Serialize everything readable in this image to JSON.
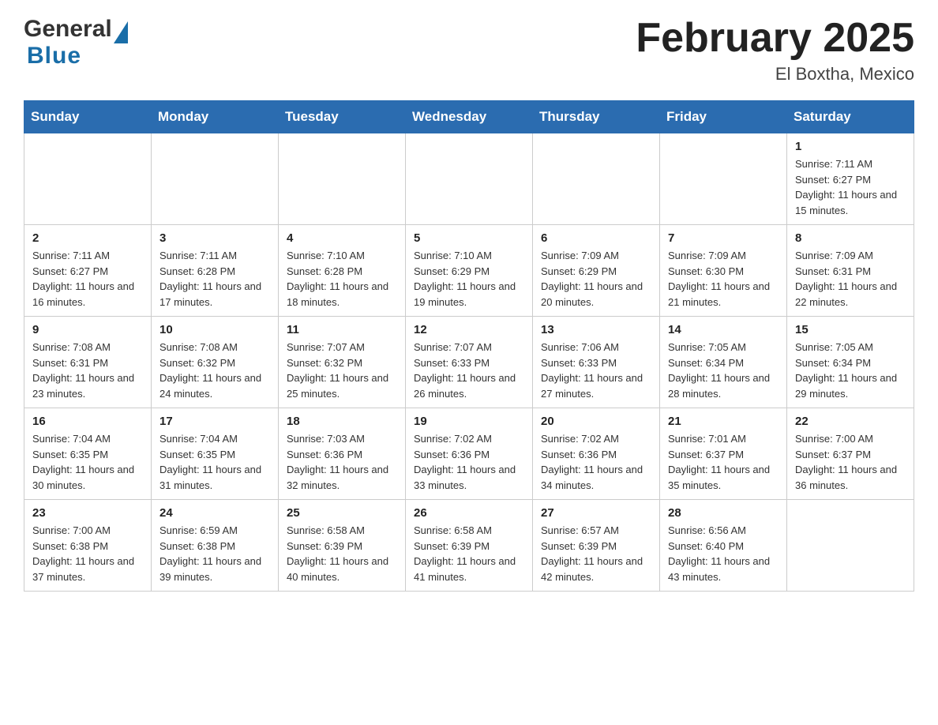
{
  "header": {
    "logo_general": "General",
    "logo_blue": "Blue",
    "month_title": "February 2025",
    "location": "El Boxtha, Mexico"
  },
  "weekdays": [
    "Sunday",
    "Monday",
    "Tuesday",
    "Wednesday",
    "Thursday",
    "Friday",
    "Saturday"
  ],
  "weeks": [
    {
      "days": [
        {
          "number": "",
          "info": ""
        },
        {
          "number": "",
          "info": ""
        },
        {
          "number": "",
          "info": ""
        },
        {
          "number": "",
          "info": ""
        },
        {
          "number": "",
          "info": ""
        },
        {
          "number": "",
          "info": ""
        },
        {
          "number": "1",
          "info": "Sunrise: 7:11 AM\nSunset: 6:27 PM\nDaylight: 11 hours and 15 minutes."
        }
      ]
    },
    {
      "days": [
        {
          "number": "2",
          "info": "Sunrise: 7:11 AM\nSunset: 6:27 PM\nDaylight: 11 hours and 16 minutes."
        },
        {
          "number": "3",
          "info": "Sunrise: 7:11 AM\nSunset: 6:28 PM\nDaylight: 11 hours and 17 minutes."
        },
        {
          "number": "4",
          "info": "Sunrise: 7:10 AM\nSunset: 6:28 PM\nDaylight: 11 hours and 18 minutes."
        },
        {
          "number": "5",
          "info": "Sunrise: 7:10 AM\nSunset: 6:29 PM\nDaylight: 11 hours and 19 minutes."
        },
        {
          "number": "6",
          "info": "Sunrise: 7:09 AM\nSunset: 6:29 PM\nDaylight: 11 hours and 20 minutes."
        },
        {
          "number": "7",
          "info": "Sunrise: 7:09 AM\nSunset: 6:30 PM\nDaylight: 11 hours and 21 minutes."
        },
        {
          "number": "8",
          "info": "Sunrise: 7:09 AM\nSunset: 6:31 PM\nDaylight: 11 hours and 22 minutes."
        }
      ]
    },
    {
      "days": [
        {
          "number": "9",
          "info": "Sunrise: 7:08 AM\nSunset: 6:31 PM\nDaylight: 11 hours and 23 minutes."
        },
        {
          "number": "10",
          "info": "Sunrise: 7:08 AM\nSunset: 6:32 PM\nDaylight: 11 hours and 24 minutes."
        },
        {
          "number": "11",
          "info": "Sunrise: 7:07 AM\nSunset: 6:32 PM\nDaylight: 11 hours and 25 minutes."
        },
        {
          "number": "12",
          "info": "Sunrise: 7:07 AM\nSunset: 6:33 PM\nDaylight: 11 hours and 26 minutes."
        },
        {
          "number": "13",
          "info": "Sunrise: 7:06 AM\nSunset: 6:33 PM\nDaylight: 11 hours and 27 minutes."
        },
        {
          "number": "14",
          "info": "Sunrise: 7:05 AM\nSunset: 6:34 PM\nDaylight: 11 hours and 28 minutes."
        },
        {
          "number": "15",
          "info": "Sunrise: 7:05 AM\nSunset: 6:34 PM\nDaylight: 11 hours and 29 minutes."
        }
      ]
    },
    {
      "days": [
        {
          "number": "16",
          "info": "Sunrise: 7:04 AM\nSunset: 6:35 PM\nDaylight: 11 hours and 30 minutes."
        },
        {
          "number": "17",
          "info": "Sunrise: 7:04 AM\nSunset: 6:35 PM\nDaylight: 11 hours and 31 minutes."
        },
        {
          "number": "18",
          "info": "Sunrise: 7:03 AM\nSunset: 6:36 PM\nDaylight: 11 hours and 32 minutes."
        },
        {
          "number": "19",
          "info": "Sunrise: 7:02 AM\nSunset: 6:36 PM\nDaylight: 11 hours and 33 minutes."
        },
        {
          "number": "20",
          "info": "Sunrise: 7:02 AM\nSunset: 6:36 PM\nDaylight: 11 hours and 34 minutes."
        },
        {
          "number": "21",
          "info": "Sunrise: 7:01 AM\nSunset: 6:37 PM\nDaylight: 11 hours and 35 minutes."
        },
        {
          "number": "22",
          "info": "Sunrise: 7:00 AM\nSunset: 6:37 PM\nDaylight: 11 hours and 36 minutes."
        }
      ]
    },
    {
      "days": [
        {
          "number": "23",
          "info": "Sunrise: 7:00 AM\nSunset: 6:38 PM\nDaylight: 11 hours and 37 minutes."
        },
        {
          "number": "24",
          "info": "Sunrise: 6:59 AM\nSunset: 6:38 PM\nDaylight: 11 hours and 39 minutes."
        },
        {
          "number": "25",
          "info": "Sunrise: 6:58 AM\nSunset: 6:39 PM\nDaylight: 11 hours and 40 minutes."
        },
        {
          "number": "26",
          "info": "Sunrise: 6:58 AM\nSunset: 6:39 PM\nDaylight: 11 hours and 41 minutes."
        },
        {
          "number": "27",
          "info": "Sunrise: 6:57 AM\nSunset: 6:39 PM\nDaylight: 11 hours and 42 minutes."
        },
        {
          "number": "28",
          "info": "Sunrise: 6:56 AM\nSunset: 6:40 PM\nDaylight: 11 hours and 43 minutes."
        },
        {
          "number": "",
          "info": ""
        }
      ]
    }
  ]
}
